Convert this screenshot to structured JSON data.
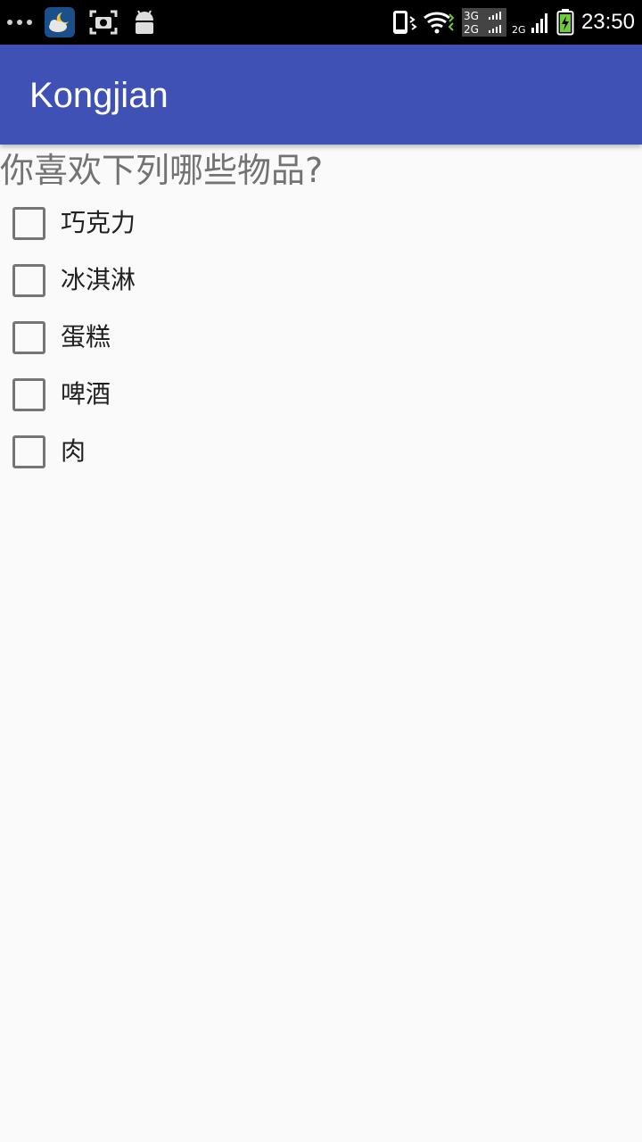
{
  "status_bar": {
    "time": "23:50",
    "network_3g": "3G",
    "network_2g": "2G",
    "network_2g_small": "2G",
    "icons": [
      "more-dots-icon",
      "weather-icon",
      "screenshot-icon",
      "android-icon",
      "vibrate-icon",
      "wifi-icon",
      "signal-3g-2g-icon",
      "signal-bars-icon",
      "battery-charging-icon"
    ]
  },
  "app_bar": {
    "title": "Kongjian",
    "color": "#3f51b5"
  },
  "question": "你喜欢下列哪些物品?",
  "checkboxes": [
    {
      "label": "巧克力",
      "checked": false
    },
    {
      "label": "冰淇淋",
      "checked": false
    },
    {
      "label": "蛋糕",
      "checked": false
    },
    {
      "label": "啤酒",
      "checked": false
    },
    {
      "label": "肉",
      "checked": false
    }
  ]
}
